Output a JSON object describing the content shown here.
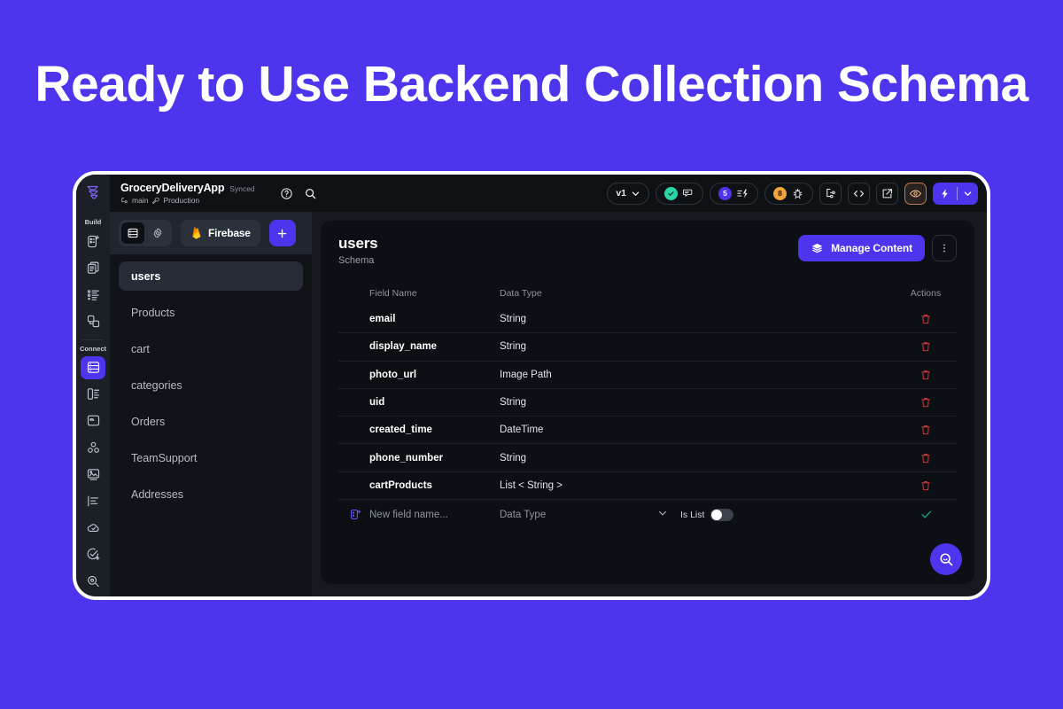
{
  "banner": {
    "heading": "Ready to Use Backend Collection Schema"
  },
  "theme": {
    "brand_purple": "#4D35EE",
    "panel_dark": "#0C0F13",
    "window_dark": "#16191D",
    "rail_dark": "#1B1F26",
    "accent_teal": "#2CD4AA",
    "accent_orange": "#F2A43A",
    "danger_red": "#E03C3C"
  },
  "topbar": {
    "logo": "flutterflow-logo-icon",
    "app_name": "GroceryDeliveryApp",
    "sync_status": "Synced",
    "branch": "main",
    "environment": "Production",
    "help_icon": "help-circle-icon",
    "search_icon": "search-icon",
    "version": "v1",
    "chat_pill": {
      "status_icon": "check-circle-icon",
      "icon": "chat-bubble-icon"
    },
    "issues_pill": {
      "count": "5",
      "icon": "lightning-list-icon"
    },
    "warnings_pill": {
      "count": "8",
      "icon": "bug-icon"
    },
    "branch_button_icon": "branch-tree-icon",
    "code_button_icon": "code-brackets-icon",
    "share_button_icon": "external-link-icon",
    "preview_button_icon": "eye-icon",
    "run_button_icon": "lightning-bolt-icon",
    "run_dropdown_icon": "chevron-down-icon"
  },
  "rail": {
    "build_label": "Build",
    "connect_label": "Connect",
    "build_items": [
      {
        "name": "new-page-icon"
      },
      {
        "name": "pages-icon"
      },
      {
        "name": "components-list-icon"
      },
      {
        "name": "widget-tree-icon"
      }
    ],
    "connect_items": [
      {
        "name": "database-icon",
        "active": true
      },
      {
        "name": "app-state-icon",
        "active": false
      },
      {
        "name": "storage-folder-icon",
        "active": false
      },
      {
        "name": "integrations-icon",
        "active": false
      },
      {
        "name": "media-assets-icon",
        "active": false
      },
      {
        "name": "local-state-icon",
        "active": false
      },
      {
        "name": "cloud-functions-icon",
        "active": false
      },
      {
        "name": "tests-icon",
        "active": false
      },
      {
        "name": "analytics-icon",
        "active": false
      }
    ]
  },
  "collections_panel": {
    "toolbar": {
      "database_tab_icon": "database-icon",
      "settings_tab_icon": "gear-icon",
      "provider_label": "Firebase",
      "provider_icon": "firebase-flame-icon",
      "add_icon": "plus-icon"
    },
    "items": [
      {
        "label": "users",
        "active": true
      },
      {
        "label": "Products",
        "active": false
      },
      {
        "label": "cart",
        "active": false
      },
      {
        "label": "categories",
        "active": false
      },
      {
        "label": "Orders",
        "active": false
      },
      {
        "label": "TeamSupport",
        "active": false
      },
      {
        "label": "Addresses",
        "active": false
      }
    ]
  },
  "main": {
    "title": "users",
    "subtitle": "Schema",
    "manage_button": {
      "label": "Manage Content",
      "icon": "layers-icon"
    },
    "kebab_icon": "more-vertical-icon",
    "table": {
      "headers": {
        "field_name": "Field Name",
        "data_type": "Data Type",
        "actions": "Actions"
      },
      "rows": [
        {
          "field_name": "email",
          "data_type": "String",
          "action_icon": "trash-icon"
        },
        {
          "field_name": "display_name",
          "data_type": "String",
          "action_icon": "trash-icon"
        },
        {
          "field_name": "photo_url",
          "data_type": "Image Path",
          "action_icon": "trash-icon"
        },
        {
          "field_name": "uid",
          "data_type": "String",
          "action_icon": "trash-icon"
        },
        {
          "field_name": "created_time",
          "data_type": "DateTime",
          "action_icon": "trash-icon"
        },
        {
          "field_name": "phone_number",
          "data_type": "String",
          "action_icon": "trash-icon"
        },
        {
          "field_name": "cartProducts",
          "data_type": "List < String >",
          "action_icon": "trash-icon"
        }
      ],
      "new_row": {
        "add_field_icon": "add-field-icon",
        "name_placeholder": "New field name...",
        "type_placeholder": "Data Type",
        "type_chevron_icon": "chevron-down-icon",
        "is_list_label": "Is List",
        "is_list_on": false,
        "confirm_icon": "check-icon"
      }
    },
    "fab_icon": "search-icon"
  }
}
